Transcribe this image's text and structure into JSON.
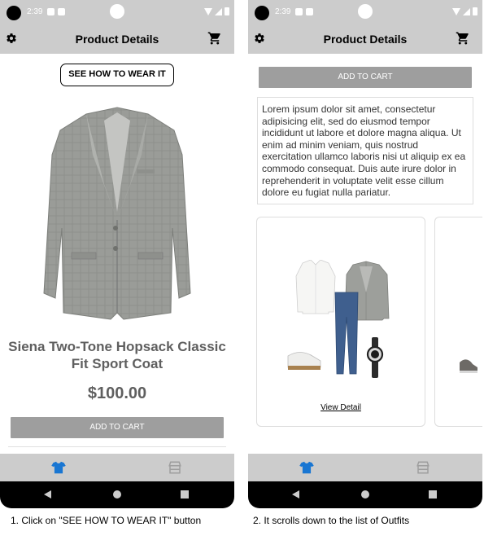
{
  "status_bar": {
    "time": "2:39"
  },
  "app_bar": {
    "title": "Product Details"
  },
  "product": {
    "wear_button_label": "SEE HOW TO WEAR IT",
    "name": "Siena Two-Tone Hopsack Classic Fit Sport Coat",
    "price": "$100.00",
    "add_to_cart_label": "ADD TO CART"
  },
  "description": "Lorem ipsum dolor sit amet, consectetur adipisicing elit, sed do eiusmod tempor incididunt ut labore et dolore magna aliqua. Ut enim ad minim veniam, quis nostrud exercitation ullamco laboris nisi ut aliquip ex ea commodo consequat. Duis aute irure dolor in reprehenderit in voluptate velit esse cillum dolore eu fugiat nulla pariatur.",
  "outfits": [
    {
      "link_label": "View Detail"
    }
  ],
  "bottom_nav": {
    "items": [
      {
        "icon": "shirt-icon",
        "active": true,
        "color": "#1976d2"
      },
      {
        "icon": "store-icon",
        "active": false,
        "color": "#9e9e9e"
      }
    ]
  },
  "captions": {
    "left": "1. Click on \"SEE HOW TO WEAR IT\" button",
    "right": "2. It scrolls down to the list of Outfits"
  },
  "colors": {
    "app_bar": "#cccccc",
    "button_gray": "#9e9e9e",
    "accent_blue": "#1976d2",
    "text_gray": "#5f5f5f"
  }
}
